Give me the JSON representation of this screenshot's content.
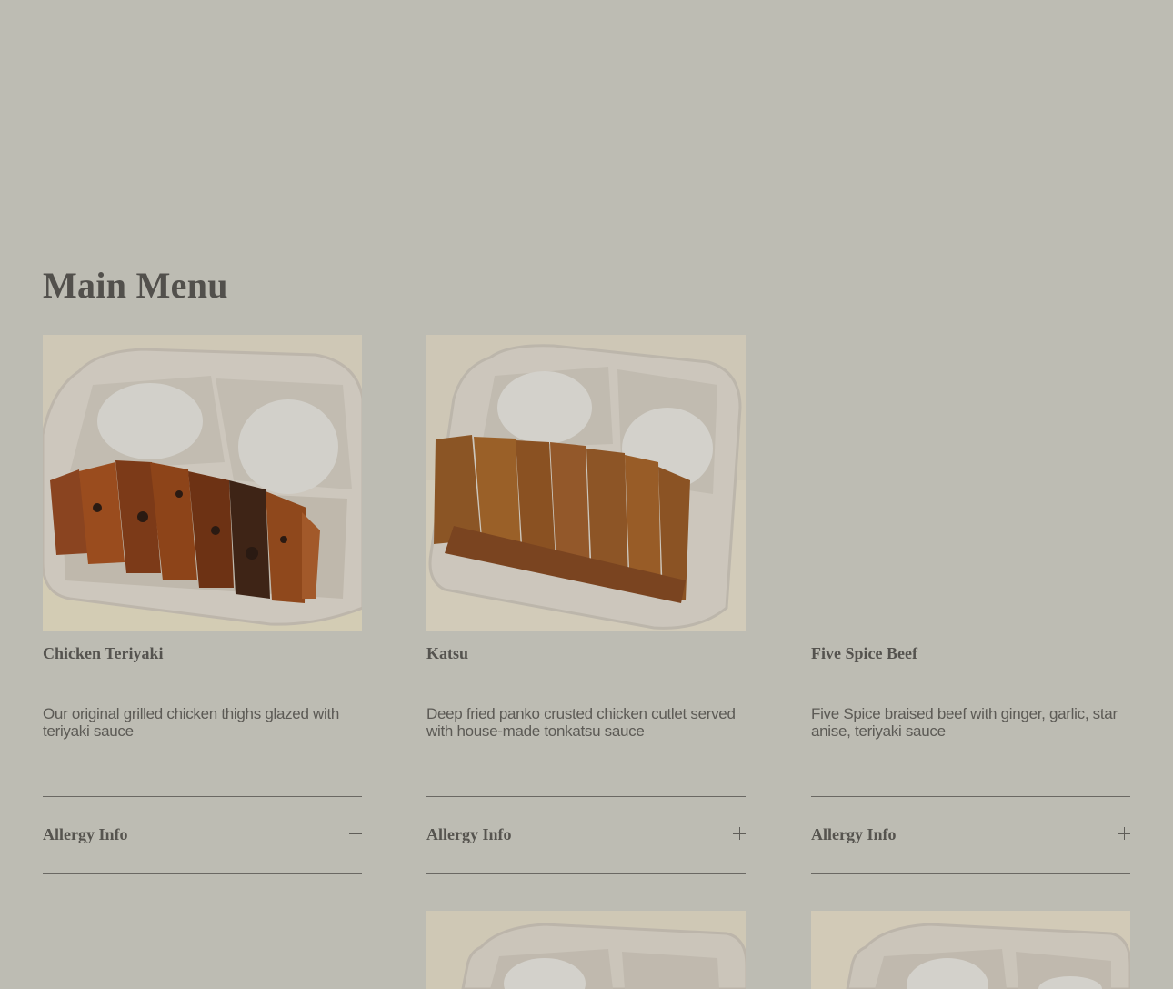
{
  "page": {
    "section_title": "Main Menu"
  },
  "menu": {
    "items": [
      {
        "name": "Chicken Teriyaki",
        "description": "Our original grilled chicken thighs glazed with teriyaki sauce",
        "image": "chicken-teriyaki-plate",
        "allergy_label": "Allergy Info"
      },
      {
        "name": "Katsu",
        "description": "Deep fried panko crusted chicken cutlet served with house-made tonkatsu sauce",
        "image": "katsu-plate",
        "allergy_label": "Allergy Info"
      },
      {
        "name": "Five Spice Beef",
        "description": "Five Spice braised beef with ginger, garlic, star anise, teriyaki sauce",
        "image": "none-visible",
        "allergy_label": "Allergy Info"
      }
    ]
  },
  "icons": {
    "expand": "plus-icon"
  },
  "colors": {
    "background": "#bdbcb3",
    "text": "#4b4a47",
    "divider": "#6a6863"
  }
}
